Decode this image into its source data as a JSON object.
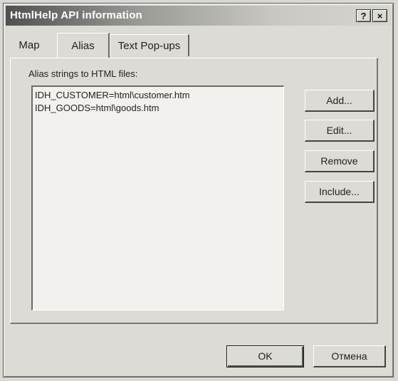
{
  "window": {
    "title": "HtmlHelp API information",
    "help_glyph": "?",
    "close_glyph": "×"
  },
  "tabs": [
    {
      "label": "Map"
    },
    {
      "label": "Alias"
    },
    {
      "label": "Text Pop-ups"
    }
  ],
  "alias_panel": {
    "list_label": "Alias strings to HTML files:",
    "items": [
      "IDH_CUSTOMER=html\\customer.htm",
      "IDH_GOODS=html\\goods.htm"
    ],
    "buttons": {
      "add": "Add...",
      "edit": "Edit...",
      "remove": "Remove",
      "include": "Include..."
    }
  },
  "footer": {
    "ok": "OK",
    "cancel": "Отмена"
  }
}
